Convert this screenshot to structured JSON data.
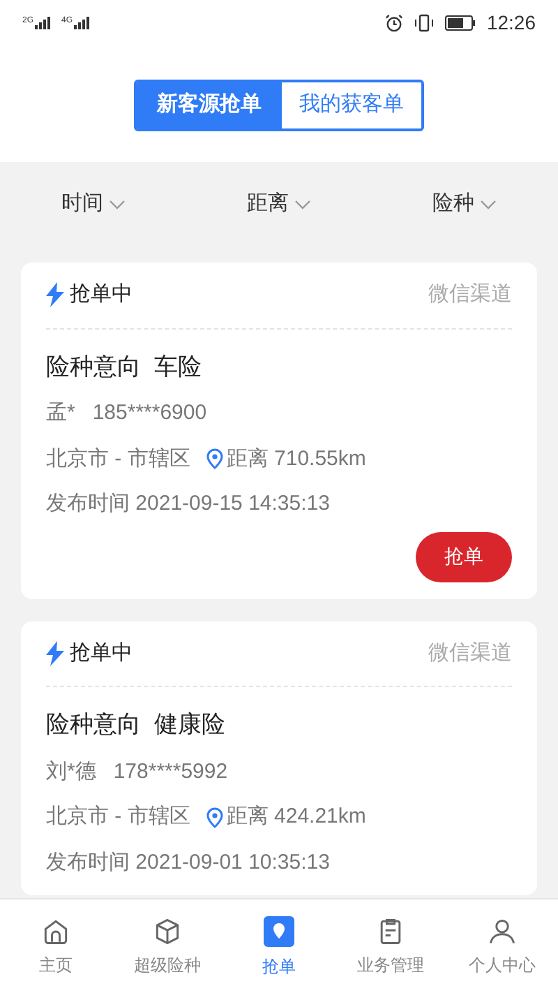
{
  "status_bar": {
    "network_1": "2G",
    "network_2": "4G",
    "time": "12:26"
  },
  "segments": [
    {
      "label": "新客源抢单",
      "selected": true
    },
    {
      "label": "我的获客单",
      "selected": false
    }
  ],
  "filters": [
    {
      "label": "时间"
    },
    {
      "label": "距离"
    },
    {
      "label": "险种"
    }
  ],
  "orders": [
    {
      "status": "抢单中",
      "channel": "微信渠道",
      "intent": "险种意向  车险",
      "contact": "孟*   185****6900",
      "location": "北京市 - 市辖区",
      "distance": "距离 710.55km",
      "published": "发布时间 2021-09-15 14:35:13",
      "action": "抢单"
    },
    {
      "status": "抢单中",
      "channel": "微信渠道",
      "intent": "险种意向  健康险",
      "contact": "刘*德   178****5992",
      "location": "北京市 - 市辖区",
      "distance": "距离 424.21km",
      "published": "发布时间 2021-09-01 10:35:13"
    }
  ],
  "tab_bar": [
    {
      "kind": "home",
      "label": "主页",
      "selected": false
    },
    {
      "kind": "cube",
      "label": "超级险种",
      "selected": false
    },
    {
      "kind": "grab",
      "label": "抢单",
      "selected": true
    },
    {
      "kind": "clipboard",
      "label": "业务管理",
      "selected": false
    },
    {
      "kind": "person",
      "label": "个人中心",
      "selected": false
    }
  ]
}
